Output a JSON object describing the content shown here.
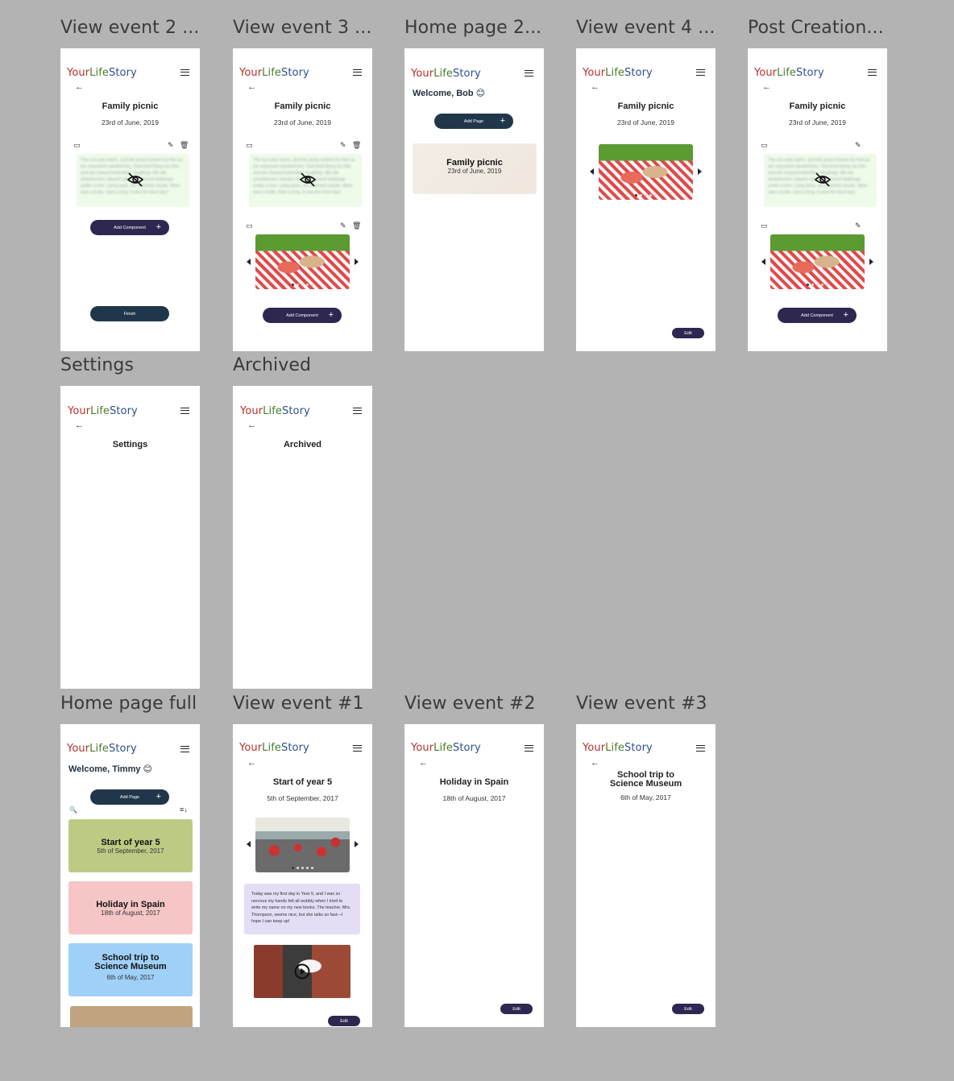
{
  "brand": {
    "your": "Your",
    "life": "Life",
    "story": "Story"
  },
  "frame_labels": {
    "view_event_2": "View event 2 ...",
    "view_event_3": "View event 3 ...",
    "home_page_2": "Home page 2...",
    "view_event_4": "View event 4 ...",
    "post_creation": "Post Creation...",
    "settings": "Settings",
    "archived": "Archived",
    "home_page_full": "Home page full",
    "view_event_1a": "View event #1",
    "view_event_2a": "View event #2",
    "view_event_3a": "View event #3"
  },
  "picnic": {
    "title": "Family picnic",
    "date": "23rd of June, 2019"
  },
  "blurred_text": "The sun was warm, and the grass tickled my feet as we unpacked sandwiches. Dad tried flying my kite, and we chased butterflies, laughing. We ate strawberries, played catch, and found ladybugs under a tree. Lying back, we watched clouds. Mom saw a turtle, Sam a frog. It was the best day!",
  "buttons": {
    "add_component": "Add Component",
    "finish": "Finish",
    "add_page": "Add Page",
    "edit": "Edit",
    "plus": "+"
  },
  "welcome_bob": "Welcome, Bob 😊",
  "welcome_timmy": "Welcome, Timmy 😊",
  "settings_title": "Settings",
  "archived_title": "Archived",
  "events": [
    {
      "title": "Start of year 5",
      "date": "5th of September, 2017",
      "color": "#bccb84"
    },
    {
      "title": "Holiday in Spain",
      "date": "18th of August, 2017",
      "color": "#f6c6c6"
    },
    {
      "title": "School trip to Science Museum",
      "date": "6th of May, 2017",
      "color": "#9fd0f8"
    }
  ],
  "school_text": "Today was my first day in Year 5, and I was so nervous my hands felt all wobbly when I tried to write my name on my new books. The teacher, Mrs. Thompson, seems nice, but she talks so fast—I hope I can keep up!",
  "school_trip_title": "School trip to Science Museum",
  "colors": {
    "accent": "#2e2750",
    "dark_button": "#20364a",
    "brand_red": "#b5302c",
    "brand_green": "#4b7a2a",
    "brand_blue": "#2d4f8f",
    "text_card_bg": "#e5dcf6",
    "blur_bg": "#eefbe9"
  },
  "icons": [
    "menu-icon",
    "back-arrow-icon",
    "archive-icon",
    "pencil-icon",
    "trash-icon",
    "eye-off-icon",
    "plus-icon",
    "search-icon",
    "sort-icon",
    "play-icon",
    "chevron-left-icon",
    "chevron-right-icon"
  ]
}
